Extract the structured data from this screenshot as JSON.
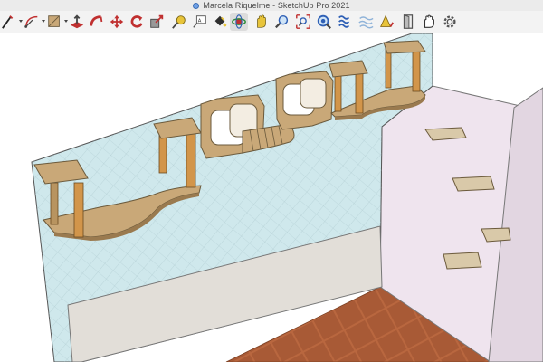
{
  "window": {
    "title": "Marcela Riquelme - SketchUp Pro 2021"
  },
  "toolbar": {
    "tools": [
      {
        "name": "line-icon"
      },
      {
        "name": "arc-icon"
      },
      {
        "name": "rectangle-icon"
      },
      {
        "name": "push-pull-icon"
      },
      {
        "name": "follow-me-icon"
      },
      {
        "name": "move-icon"
      },
      {
        "name": "rotate-icon"
      },
      {
        "name": "scale-icon"
      },
      {
        "name": "tape-measure-icon"
      },
      {
        "name": "text-icon"
      },
      {
        "name": "paint-bucket-icon"
      },
      {
        "name": "orbit-icon"
      },
      {
        "name": "pan-icon"
      },
      {
        "name": "zoom-icon"
      },
      {
        "name": "zoom-extents-icon"
      },
      {
        "name": "search-icon"
      },
      {
        "name": "section-plane-icon"
      },
      {
        "name": "fog-icon"
      },
      {
        "name": "door-icon"
      },
      {
        "name": "hand-icon"
      },
      {
        "name": "settings-gear-icon"
      }
    ]
  },
  "colors": {
    "wood": "#c9a878",
    "wood_dark": "#9a7a4f",
    "post": "#d2954a",
    "glass": "#cfe8ec",
    "wall": "#efe4ee",
    "floor": "#b9673f"
  }
}
